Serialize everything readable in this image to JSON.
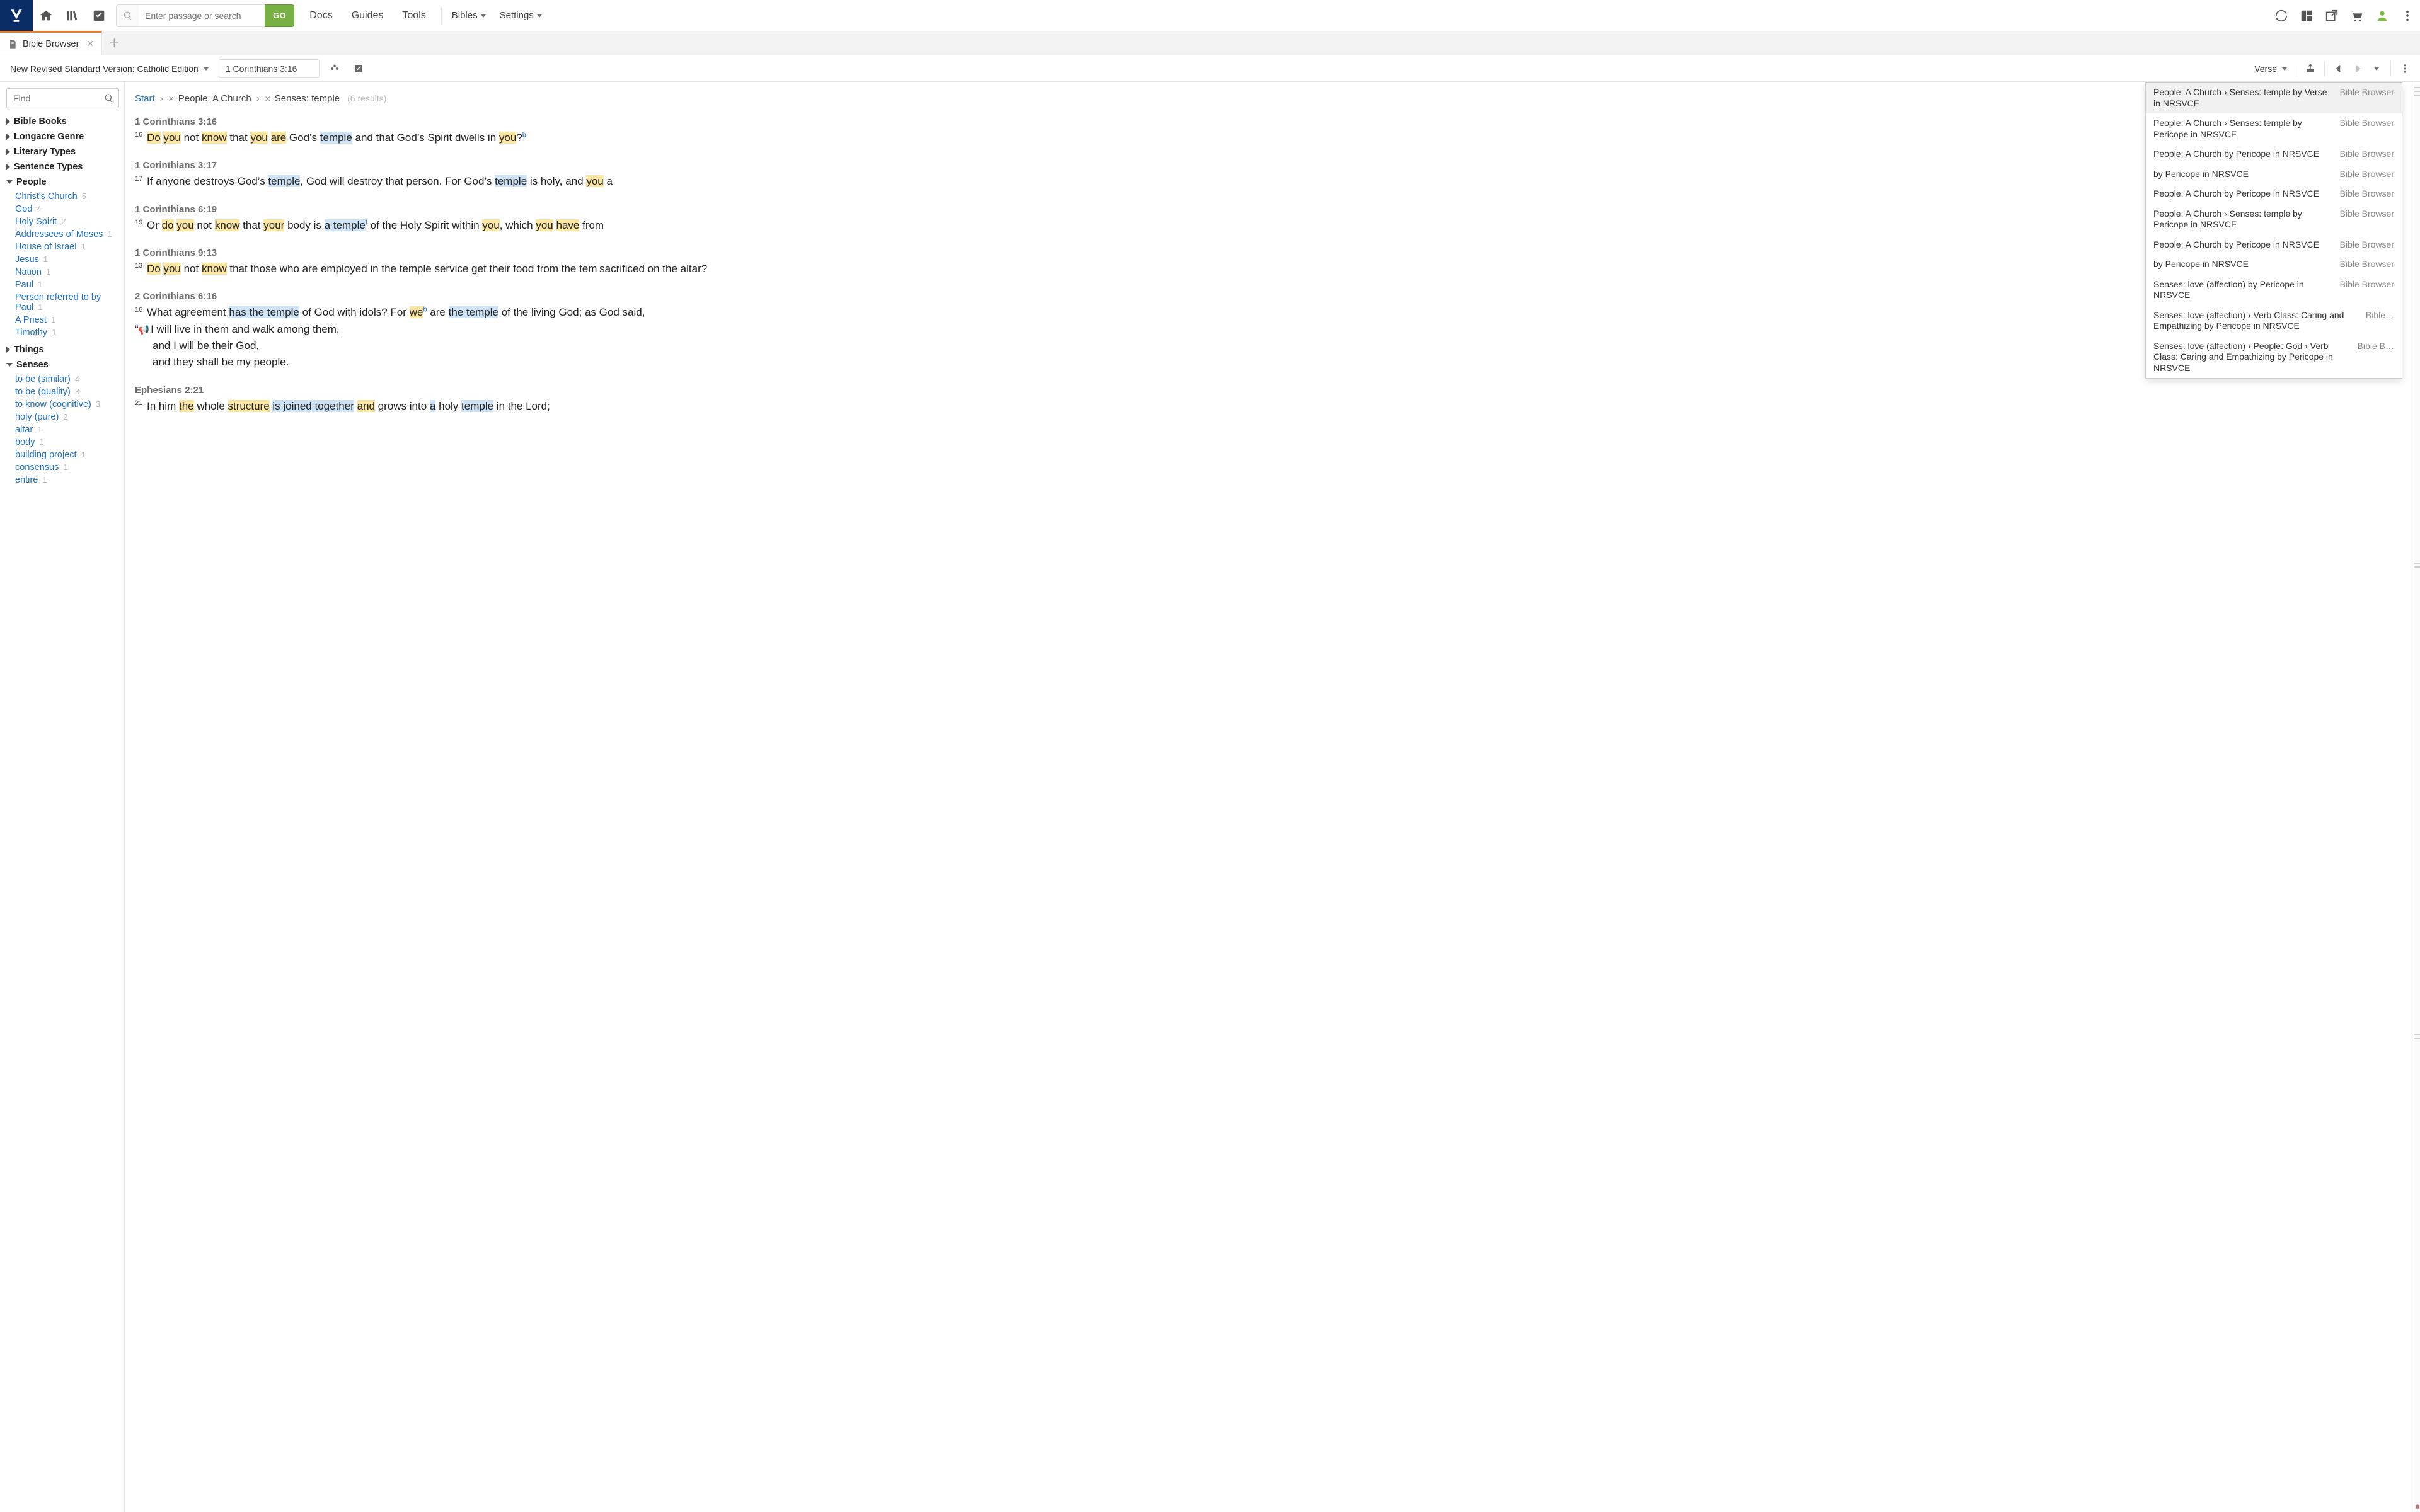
{
  "topbar": {
    "search_placeholder": "Enter passage or search",
    "go_label": "GO",
    "menu": {
      "docs": "Docs",
      "guides": "Guides",
      "tools": "Tools"
    },
    "dd_bibles": "Bibles",
    "dd_settings": "Settings"
  },
  "tabs": {
    "active": {
      "title": "Bible Browser"
    }
  },
  "doctoolbar": {
    "version": "New Revised Standard Version: Catholic Edition",
    "reference": "1 Corinthians 3:16",
    "view_mode": "Verse"
  },
  "sidebar": {
    "find_placeholder": "Find",
    "groups": [
      {
        "label": "Bible Books",
        "open": false
      },
      {
        "label": "Longacre Genre",
        "open": false
      },
      {
        "label": "Literary Types",
        "open": false
      },
      {
        "label": "Sentence Types",
        "open": false
      },
      {
        "label": "People",
        "open": true,
        "children": [
          {
            "label": "Christ's Church",
            "count": "5"
          },
          {
            "label": "God",
            "count": "4"
          },
          {
            "label": "Holy Spirit",
            "count": "2"
          },
          {
            "label": "Addressees of Moses",
            "count": "1"
          },
          {
            "label": "House of Israel",
            "count": "1"
          },
          {
            "label": "Jesus",
            "count": "1"
          },
          {
            "label": "Nation",
            "count": "1"
          },
          {
            "label": "Paul",
            "count": "1"
          },
          {
            "label": "Person referred to by Paul",
            "count": "1"
          },
          {
            "label": "A Priest",
            "count": "1"
          },
          {
            "label": "Timothy",
            "count": "1"
          }
        ]
      },
      {
        "label": "Things",
        "open": false
      },
      {
        "label": "Senses",
        "open": true,
        "children": [
          {
            "label": "to be (similar)",
            "count": "4"
          },
          {
            "label": "to be (quality)",
            "count": "3"
          },
          {
            "label": "to know (cognitive)",
            "count": "3"
          },
          {
            "label": "holy (pure)",
            "count": "2"
          },
          {
            "label": "altar",
            "count": "1"
          },
          {
            "label": "body",
            "count": "1"
          },
          {
            "label": "building project",
            "count": "1"
          },
          {
            "label": "consensus",
            "count": "1"
          },
          {
            "label": "entire",
            "count": "1"
          }
        ]
      }
    ]
  },
  "breadcrumb": {
    "start": "Start",
    "seg1": "People: A Church",
    "seg2": "Senses: temple",
    "results_label": "(6 results)"
  },
  "verses": [
    {
      "ref": "1 Corinthians 3:16",
      "num": "16",
      "html": "<span class='hl-y'>Do</span> <span class='hl-y'>you</span> not <span class='hl-y'>know</span> that <span class='hl-y'>you</span> <span class='hl-y'>are</span> God’s <span class='hl-b'>temple</span> and that God’s Spirit dwells in <span class='hl-y'>you</span>?<span class='fn'>b</span>"
    },
    {
      "ref": "1 Corinthians 3:17",
      "num": "17",
      "html": "If anyone destroys God’s <span class='hl-b'>temple</span>, God will destroy that person. For God’s <span class='hl-b'>temple</span> is holy, and <span class='hl-y'>you</span> a"
    },
    {
      "ref": "1 Corinthians 6:19",
      "num": "19",
      "html": "Or <span class='hl-y'>do</span> <span class='hl-y'>you</span> not <span class='hl-y'>know</span> that <span class='hl-y'>your</span> body is <span class='hl-b'>a temple</span><span class='fn'>f</span> of the Holy Spirit within <span class='hl-y'>you</span>, which <span class='hl-y'>you</span> <span class='hl-y'>have</span> from"
    },
    {
      "ref": "1 Corinthians 9:13",
      "num": "13",
      "html": "<span class='hl-y'>Do</span> <span class='hl-y'>you</span> not <span class='hl-y'>know</span> that those who are employed in the temple service get their food from the te<span style='letter-spacing:-1px;'>m</span> sacrificed on the altar?"
    },
    {
      "ref": "2 Corinthians 6:16",
      "num": "16",
      "html": "What agreement <span class='hl-b'>has the temple</span> of God with idols? For <span class='hl-y'>we</span><span class='fn'>b</span> are <span class='hl-b'>the temple</span> of the living God; as God said,<br>“<span class='quote-marker'>📢</span>I will live in them and walk among them,<br><span class='indent'>and I will be their God,</span><span class='indent'>and they shall be my people.</span>"
    },
    {
      "ref": "Ephesians 2:21",
      "num": "21",
      "html": "In him <span class='hl-y'>the</span> whole <span class='hl-y'>structure</span> <span class='hl-b'>is joined together</span> <span class='hl-y'>and</span> grows into <span class='hl-b'>a</span> holy <span class='hl-b'>temple</span> in the Lord;"
    }
  ],
  "history": [
    {
      "title": "People: A Church › Senses: temple by Verse in NRSVCE",
      "src": "Bible Browser"
    },
    {
      "title": "People: A Church › Senses: temple by Pericope in NRSVCE",
      "src": "Bible Browser"
    },
    {
      "title": "People: A Church by Pericope in NRSVCE",
      "src": "Bible Browser"
    },
    {
      "title": "by Pericope in NRSVCE",
      "src": "Bible Browser"
    },
    {
      "title": "People: A Church by Pericope in NRSVCE",
      "src": "Bible Browser"
    },
    {
      "title": "People: A Church › Senses: temple by Pericope in NRSVCE",
      "src": "Bible Browser"
    },
    {
      "title": "People: A Church by Pericope in NRSVCE",
      "src": "Bible Browser"
    },
    {
      "title": "by Pericope in NRSVCE",
      "src": "Bible Browser"
    },
    {
      "title": "Senses: love (affection) by Pericope in NRSVCE",
      "src": "Bible Browser"
    },
    {
      "title": "Senses: love (affection) › Verb Class: Caring and Empathizing by Pericope in NRSVCE",
      "src": "Bible…"
    },
    {
      "title": "Senses: love (affection) › People: God › Verb Class: Caring and Empathizing by Pericope in NRSVCE",
      "src": "Bible B…"
    }
  ]
}
